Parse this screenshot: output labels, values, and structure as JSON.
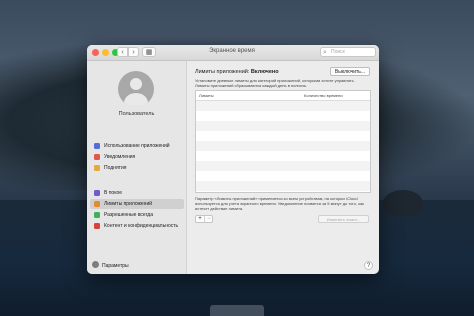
{
  "window": {
    "title": "Экранное время"
  },
  "search": {
    "placeholder": "Поиск",
    "icon": "search-icon"
  },
  "nav": {
    "back_icon": "‹",
    "forward_icon": "›",
    "grid_icon": "▦"
  },
  "user": {
    "name": "Пользователь"
  },
  "sidebar": {
    "items": [
      {
        "label": "Использование приложений",
        "icon": "hourglass-icon",
        "color": "#5a6ad8",
        "active": false
      },
      {
        "label": "Уведомления",
        "icon": "bell-icon",
        "color": "#e0574f",
        "active": false
      },
      {
        "label": "Поднятия",
        "icon": "phone-icon",
        "color": "#e6a93a",
        "active": false
      },
      {
        "label": "В покое",
        "icon": "moon-icon",
        "color": "#6e5cc8",
        "active": false
      },
      {
        "label": "Лимиты приложений",
        "icon": "hourglass-icon",
        "color": "#e58a2e",
        "active": true
      },
      {
        "label": "Разрешенные всегда",
        "icon": "check-icon",
        "color": "#3eb05a",
        "active": false
      },
      {
        "label": "Контент и конфиденциальность",
        "icon": "no-entry-icon",
        "color": "#d9423a",
        "active": false
      }
    ],
    "settings_label": "Параметры"
  },
  "main": {
    "title_prefix": "Лимиты приложений:",
    "title_status": "Включено",
    "off_button": "Выключить...",
    "description": "Установите дневные лимиты для категорий приложений, которыми хотите управлять. Лимиты приложений сбрасываются каждый день в полночь.",
    "table": {
      "col_limits": "Лимиты",
      "col_time": "Количество времени"
    },
    "footer_text": "Параметр «Лимиты приложений» применяется ко всем устройствам, на которых iCloud используется для учета экранного времени. Уведомление появится за 5 минут до того, как истечет действие лимита.",
    "add_button": "+",
    "remove_button": "−",
    "change_button": "Изменить лимит...",
    "help_button": "?"
  }
}
